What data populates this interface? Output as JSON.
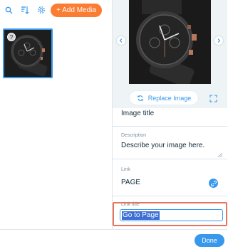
{
  "toolbar": {
    "search_icon": "search-icon",
    "sort_icon": "sort-icon",
    "settings_icon": "gear-icon",
    "add_media_label": "+ Add Media"
  },
  "media": {
    "items": [
      {
        "badge": "?"
      }
    ]
  },
  "preview": {
    "replace_label": "Replace Image"
  },
  "fields": {
    "title_value": "Image title",
    "description_label": "Description",
    "description_value": "Describe your image here.",
    "link_label": "Link",
    "link_value": "PAGE",
    "link_title_label": "Link title",
    "link_title_value": "Go to Page"
  },
  "footer": {
    "done_label": "Done"
  },
  "colors": {
    "accent": "#3899ec",
    "add_media": "#fb7d33",
    "highlight": "#e8745d",
    "selection": "#3d6fd4"
  }
}
